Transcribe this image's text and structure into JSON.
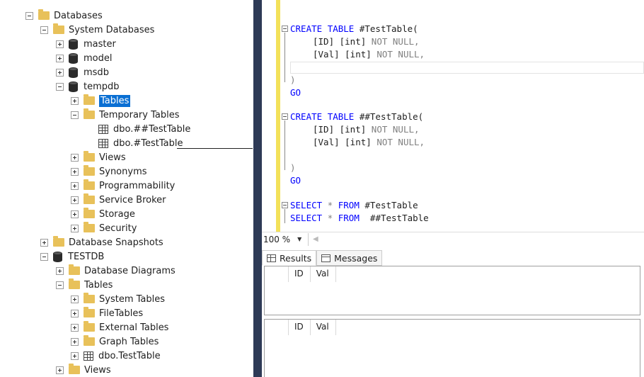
{
  "explorer": {
    "databases": "Databases",
    "system_databases": "System Databases",
    "master": "master",
    "model": "model",
    "msdb": "msdb",
    "tempdb": "tempdb",
    "tables": "Tables",
    "temporary_tables": "Temporary Tables",
    "global_temp_table": "dbo.##TestTable",
    "local_temp_table": "dbo.#TestTable",
    "views": "Views",
    "synonyms": "Synonyms",
    "programmability": "Programmability",
    "service_broker": "Service Broker",
    "storage": "Storage",
    "security": "Security",
    "database_snapshots": "Database Snapshots",
    "testdb": "TESTDB",
    "database_diagrams": "Database Diagrams",
    "testdb_tables": "Tables",
    "system_tables": "System Tables",
    "file_tables": "FileTables",
    "external_tables": "External Tables",
    "graph_tables": "Graph Tables",
    "test_table": "dbo.TestTable",
    "views2": "Views"
  },
  "editor": {
    "kw_create": "CREATE",
    "kw_table": "TABLE",
    "local_name": "#TestTable(",
    "global_name": "##TestTable(",
    "id_col": "[ID] [int]",
    "val_col": "[Val] [int]",
    "not_null": "NOT NULL,",
    "close_paren": ")",
    "go": "GO",
    "kw_select": "SELECT",
    "star": "*",
    "kw_from": "FROM",
    "select_local": "#TestTable",
    "select_global": "##TestTable"
  },
  "zoom": {
    "value": "100 %"
  },
  "results": {
    "tab_results": "Results",
    "tab_messages": "Messages",
    "grid1_cols": [
      "ID",
      "Val"
    ],
    "grid2_cols": [
      "ID",
      "Val"
    ]
  },
  "colors": {
    "keyword": "#0000ff",
    "gray": "#808080",
    "selection": "#0a6fd3",
    "splitter": "#2e3a56",
    "change_margin": "#f3e15a"
  }
}
